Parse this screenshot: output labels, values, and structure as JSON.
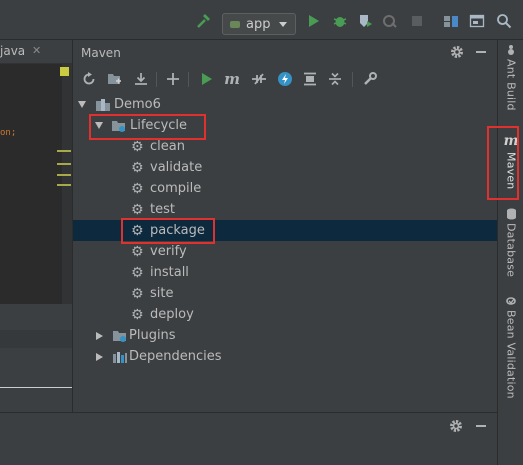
{
  "toolbar": {
    "run_config": "app"
  },
  "editor": {
    "tab_label": "java",
    "code_fragment": "on;"
  },
  "maven": {
    "title": "Maven",
    "tree": {
      "project": "Demo6",
      "lifecycle": {
        "label": "Lifecycle",
        "phases": [
          "clean",
          "validate",
          "compile",
          "test",
          "package",
          "verify",
          "install",
          "site",
          "deploy"
        ],
        "selected": "package"
      },
      "plugins": "Plugins",
      "dependencies": "Dependencies"
    }
  },
  "side_stripe": {
    "items": [
      "Ant Build",
      "Maven",
      "Database",
      "Bean Validation"
    ]
  },
  "colors": {
    "panel_bg": "#3c3f41",
    "selection": "#0d293e",
    "highlight_box": "#e0312f",
    "run_green": "#499c54"
  }
}
